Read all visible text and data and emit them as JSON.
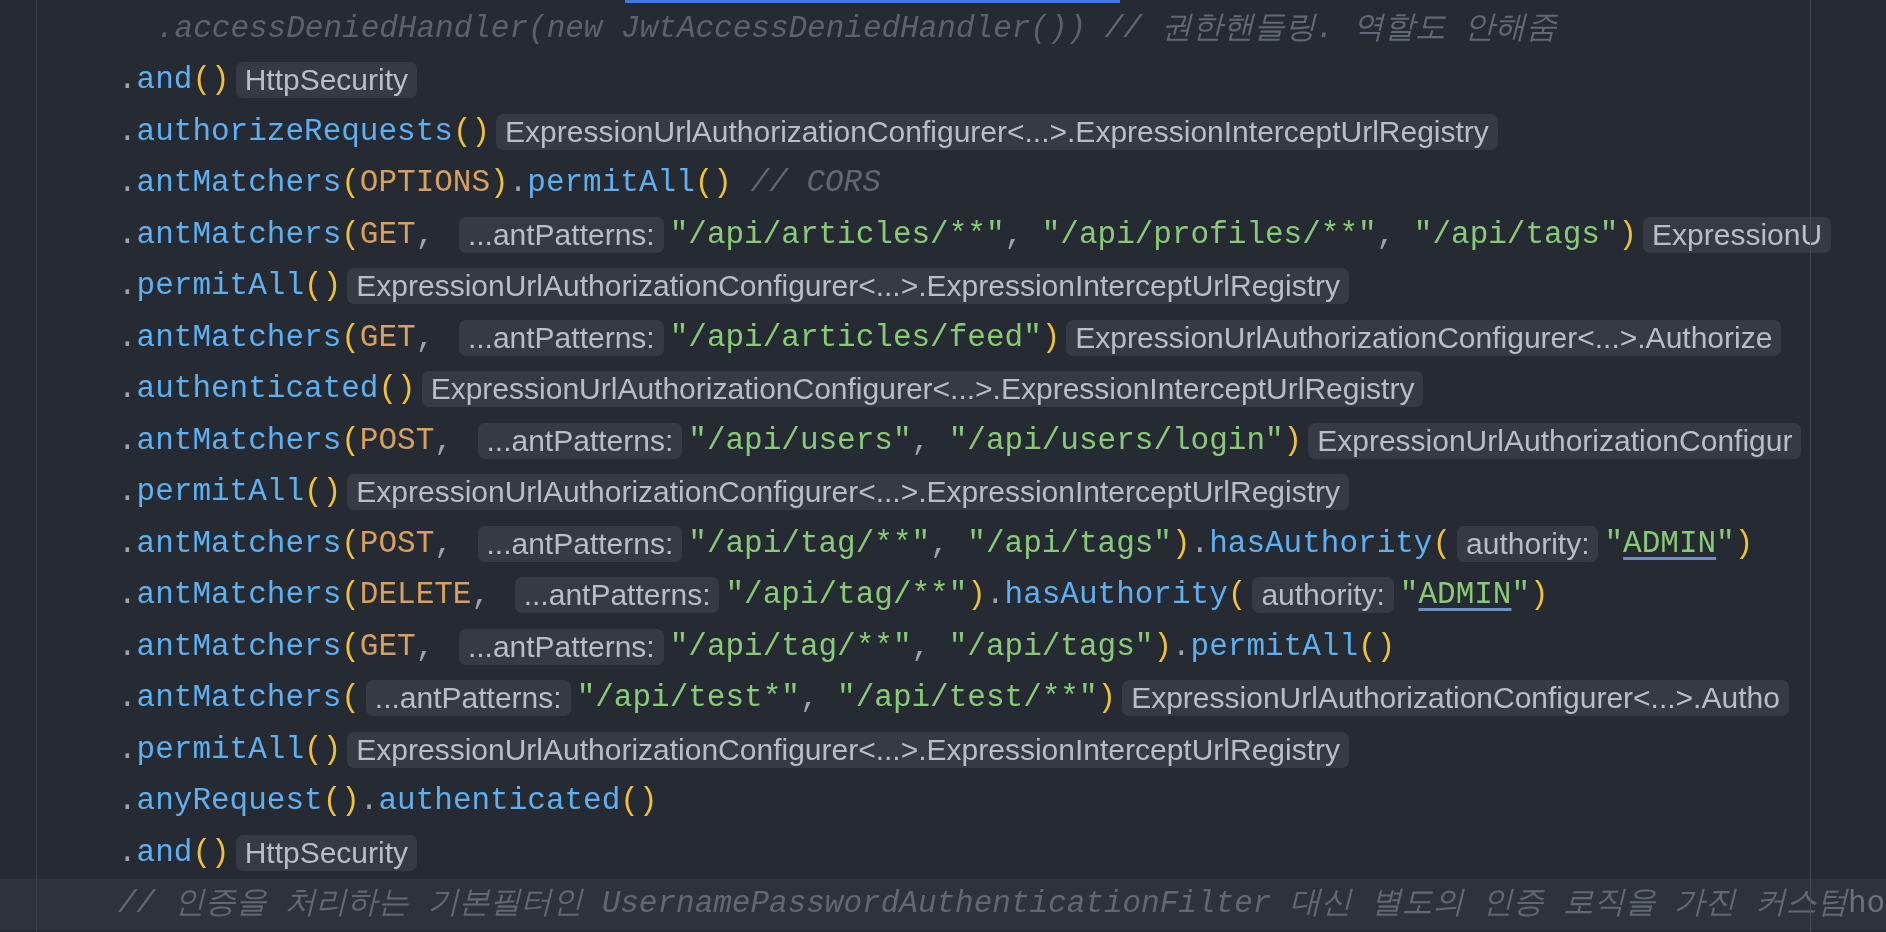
{
  "editor": {
    "lines": [
      {
        "kind": "nested",
        "tokens": [
          {
            "kind": "dim",
            "text": ".accessDeniedHandler(new JwtAccessDeniedHandler())"
          },
          {
            "kind": "comment",
            "text": " // 권한핸들링. 역할도 안해줌"
          }
        ]
      },
      {
        "kind": "chain",
        "tokens": [
          {
            "kind": "punct",
            "text": "."
          },
          {
            "kind": "method",
            "text": "and"
          },
          {
            "kind": "paren",
            "text": "()"
          },
          {
            "kind": "hint",
            "text": "HttpSecurity"
          }
        ]
      },
      {
        "kind": "chain",
        "tokens": [
          {
            "kind": "punct",
            "text": "."
          },
          {
            "kind": "method",
            "text": "authorizeRequests"
          },
          {
            "kind": "paren",
            "text": "()"
          },
          {
            "kind": "hint",
            "text": "ExpressionUrlAuthorizationConfigurer<...>.ExpressionInterceptUrlRegistry"
          }
        ]
      },
      {
        "kind": "chain",
        "tokens": [
          {
            "kind": "punct",
            "text": "."
          },
          {
            "kind": "method",
            "text": "antMatchers"
          },
          {
            "kind": "paren",
            "text": "("
          },
          {
            "kind": "const",
            "text": "OPTIONS"
          },
          {
            "kind": "paren",
            "text": ")"
          },
          {
            "kind": "punct",
            "text": "."
          },
          {
            "kind": "method",
            "text": "permitAll"
          },
          {
            "kind": "paren",
            "text": "()"
          },
          {
            "kind": "comment",
            "text": " // CORS"
          }
        ]
      },
      {
        "kind": "chain",
        "tokens": [
          {
            "kind": "punct",
            "text": "."
          },
          {
            "kind": "method",
            "text": "antMatchers"
          },
          {
            "kind": "paren",
            "text": "("
          },
          {
            "kind": "const",
            "text": "GET"
          },
          {
            "kind": "punct",
            "text": ", "
          },
          {
            "kind": "hint",
            "text": "...antPatterns:"
          },
          {
            "kind": "string",
            "text": "\"/api/articles/**\""
          },
          {
            "kind": "punct",
            "text": ", "
          },
          {
            "kind": "string",
            "text": "\"/api/profiles/**\""
          },
          {
            "kind": "punct",
            "text": ", "
          },
          {
            "kind": "string",
            "text": "\"/api/tags\""
          },
          {
            "kind": "paren",
            "text": ")"
          },
          {
            "kind": "hint",
            "text": "ExpressionU"
          }
        ]
      },
      {
        "kind": "chain",
        "tokens": [
          {
            "kind": "punct",
            "text": "."
          },
          {
            "kind": "method",
            "text": "permitAll"
          },
          {
            "kind": "paren",
            "text": "()"
          },
          {
            "kind": "hint",
            "text": "ExpressionUrlAuthorizationConfigurer<...>.ExpressionInterceptUrlRegistry"
          }
        ]
      },
      {
        "kind": "chain",
        "tokens": [
          {
            "kind": "punct",
            "text": "."
          },
          {
            "kind": "method",
            "text": "antMatchers"
          },
          {
            "kind": "paren",
            "text": "("
          },
          {
            "kind": "const",
            "text": "GET"
          },
          {
            "kind": "punct",
            "text": ", "
          },
          {
            "kind": "hint",
            "text": "...antPatterns:"
          },
          {
            "kind": "string",
            "text": "\"/api/articles/feed\""
          },
          {
            "kind": "paren",
            "text": ")"
          },
          {
            "kind": "hint",
            "text": "ExpressionUrlAuthorizationConfigurer<...>.Authorize"
          }
        ]
      },
      {
        "kind": "chain",
        "tokens": [
          {
            "kind": "punct",
            "text": "."
          },
          {
            "kind": "method",
            "text": "authenticated"
          },
          {
            "kind": "paren",
            "text": "()"
          },
          {
            "kind": "hint",
            "text": "ExpressionUrlAuthorizationConfigurer<...>.ExpressionInterceptUrlRegistry"
          }
        ]
      },
      {
        "kind": "chain",
        "tokens": [
          {
            "kind": "punct",
            "text": "."
          },
          {
            "kind": "method",
            "text": "antMatchers"
          },
          {
            "kind": "paren",
            "text": "("
          },
          {
            "kind": "const",
            "text": "POST"
          },
          {
            "kind": "punct",
            "text": ", "
          },
          {
            "kind": "hint",
            "text": "...antPatterns:"
          },
          {
            "kind": "string",
            "text": "\"/api/users\""
          },
          {
            "kind": "punct",
            "text": ", "
          },
          {
            "kind": "string",
            "text": "\"/api/users/login\""
          },
          {
            "kind": "paren",
            "text": ")"
          },
          {
            "kind": "hint",
            "text": "ExpressionUrlAuthorizationConfigur"
          }
        ]
      },
      {
        "kind": "chain",
        "tokens": [
          {
            "kind": "punct",
            "text": "."
          },
          {
            "kind": "method",
            "text": "permitAll"
          },
          {
            "kind": "paren",
            "text": "()"
          },
          {
            "kind": "hint",
            "text": "ExpressionUrlAuthorizationConfigurer<...>.ExpressionInterceptUrlRegistry"
          }
        ]
      },
      {
        "kind": "chain",
        "tokens": [
          {
            "kind": "punct",
            "text": "."
          },
          {
            "kind": "method",
            "text": "antMatchers"
          },
          {
            "kind": "paren",
            "text": "("
          },
          {
            "kind": "const",
            "text": "POST"
          },
          {
            "kind": "punct",
            "text": ", "
          },
          {
            "kind": "hint",
            "text": "...antPatterns:"
          },
          {
            "kind": "string",
            "text": "\"/api/tag/**\""
          },
          {
            "kind": "punct",
            "text": ", "
          },
          {
            "kind": "string",
            "text": "\"/api/tags\""
          },
          {
            "kind": "paren",
            "text": ")"
          },
          {
            "kind": "punct",
            "text": "."
          },
          {
            "kind": "method",
            "text": "hasAuthority"
          },
          {
            "kind": "paren",
            "text": "("
          },
          {
            "kind": "hint",
            "text": "authority:"
          },
          {
            "kind": "string",
            "text": "\""
          },
          {
            "kind": "reference",
            "text": "ADMIN"
          },
          {
            "kind": "string",
            "text": "\""
          },
          {
            "kind": "paren",
            "text": ")"
          }
        ]
      },
      {
        "kind": "chain",
        "tokens": [
          {
            "kind": "punct",
            "text": "."
          },
          {
            "kind": "method",
            "text": "antMatchers"
          },
          {
            "kind": "paren",
            "text": "("
          },
          {
            "kind": "const",
            "text": "DELETE"
          },
          {
            "kind": "punct",
            "text": ", "
          },
          {
            "kind": "hint",
            "text": "...antPatterns:"
          },
          {
            "kind": "string",
            "text": "\"/api/tag/**\""
          },
          {
            "kind": "paren",
            "text": ")"
          },
          {
            "kind": "punct",
            "text": "."
          },
          {
            "kind": "method",
            "text": "hasAuthority"
          },
          {
            "kind": "paren",
            "text": "("
          },
          {
            "kind": "hint",
            "text": "authority:"
          },
          {
            "kind": "string",
            "text": "\""
          },
          {
            "kind": "reference",
            "text": "ADMIN"
          },
          {
            "kind": "string",
            "text": "\""
          },
          {
            "kind": "paren",
            "text": ")"
          }
        ]
      },
      {
        "kind": "chain",
        "tokens": [
          {
            "kind": "punct",
            "text": "."
          },
          {
            "kind": "method",
            "text": "antMatchers"
          },
          {
            "kind": "paren",
            "text": "("
          },
          {
            "kind": "const",
            "text": "GET"
          },
          {
            "kind": "punct",
            "text": ", "
          },
          {
            "kind": "hint",
            "text": "...antPatterns:"
          },
          {
            "kind": "string",
            "text": "\"/api/tag/**\""
          },
          {
            "kind": "punct",
            "text": ", "
          },
          {
            "kind": "string",
            "text": "\"/api/tags\""
          },
          {
            "kind": "paren",
            "text": ")"
          },
          {
            "kind": "punct",
            "text": "."
          },
          {
            "kind": "method",
            "text": "permitAll"
          },
          {
            "kind": "paren",
            "text": "()"
          }
        ]
      },
      {
        "kind": "chain",
        "tokens": [
          {
            "kind": "punct",
            "text": "."
          },
          {
            "kind": "method",
            "text": "antMatchers"
          },
          {
            "kind": "paren",
            "text": "("
          },
          {
            "kind": "hint",
            "text": "...antPatterns:"
          },
          {
            "kind": "string",
            "text": "\"/api/test*\""
          },
          {
            "kind": "punct",
            "text": ", "
          },
          {
            "kind": "string",
            "text": "\"/api/test/**\""
          },
          {
            "kind": "paren",
            "text": ")"
          },
          {
            "kind": "hint",
            "text": "ExpressionUrlAuthorizationConfigurer<...>.Autho"
          }
        ]
      },
      {
        "kind": "chain",
        "tokens": [
          {
            "kind": "punct",
            "text": "."
          },
          {
            "kind": "method",
            "text": "permitAll"
          },
          {
            "kind": "paren",
            "text": "()"
          },
          {
            "kind": "hint",
            "text": "ExpressionUrlAuthorizationConfigurer<...>.ExpressionInterceptUrlRegistry"
          }
        ]
      },
      {
        "kind": "chain",
        "tokens": [
          {
            "kind": "punct",
            "text": "."
          },
          {
            "kind": "method",
            "text": "anyRequest"
          },
          {
            "kind": "paren",
            "text": "()"
          },
          {
            "kind": "punct",
            "text": "."
          },
          {
            "kind": "method",
            "text": "authenticated"
          },
          {
            "kind": "paren",
            "text": "()"
          }
        ]
      },
      {
        "kind": "chain",
        "tokens": [
          {
            "kind": "punct",
            "text": "."
          },
          {
            "kind": "method",
            "text": "and"
          },
          {
            "kind": "paren",
            "text": "()"
          },
          {
            "kind": "hint",
            "text": "HttpSecurity"
          }
        ]
      },
      {
        "kind": "chain",
        "tokens": [
          {
            "kind": "comment",
            "text": "// 인증을 처리하는 기본필터인 "
          },
          {
            "kind": "comment-code",
            "text": "UsernamePasswordAuthenticationFilter"
          },
          {
            "kind": "comment",
            "text": " 대신 별도의 인증 로직을 가진 "
          },
          {
            "kind": "caret"
          },
          {
            "kind": "comment",
            "text": "커스텀"
          },
          {
            "kind": "tail",
            "text": "ho"
          }
        ]
      }
    ]
  }
}
